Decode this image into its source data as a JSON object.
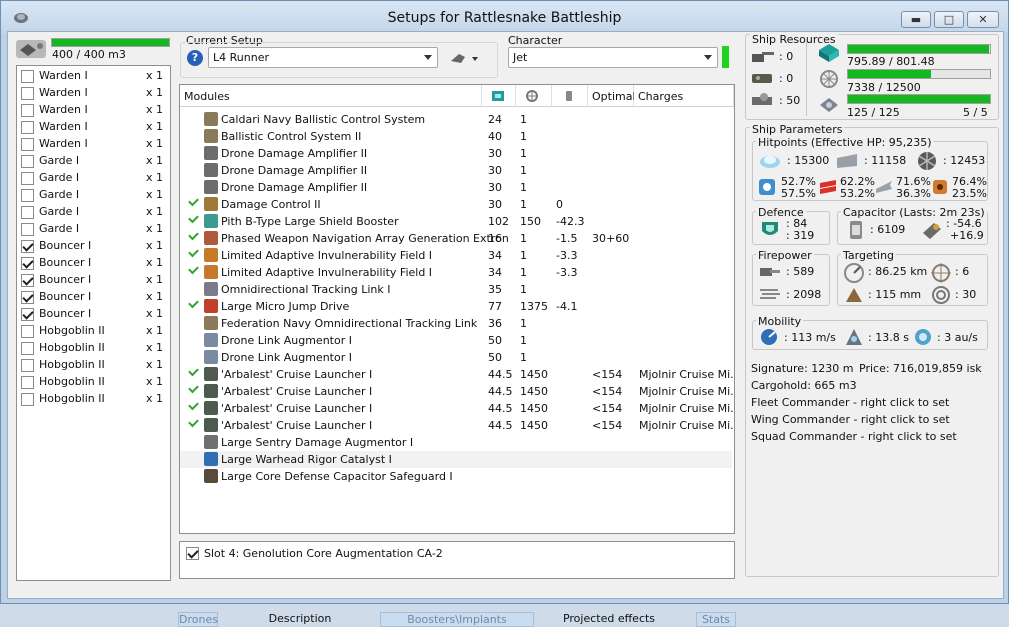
{
  "window": {
    "title": "Setups for Rattlesnake Battleship",
    "btn_min": "▬",
    "btn_max": "□",
    "btn_close": "✕"
  },
  "ship": {
    "drone_bay": "400 / 400 m3",
    "drone_bay_fraction": 1.0
  },
  "drones": [
    {
      "name": "Warden I",
      "qty": "x 1",
      "checked": false
    },
    {
      "name": "Warden I",
      "qty": "x 1",
      "checked": false
    },
    {
      "name": "Warden I",
      "qty": "x 1",
      "checked": false
    },
    {
      "name": "Warden I",
      "qty": "x 1",
      "checked": false
    },
    {
      "name": "Warden I",
      "qty": "x 1",
      "checked": false
    },
    {
      "name": "Garde I",
      "qty": "x 1",
      "checked": false
    },
    {
      "name": "Garde I",
      "qty": "x 1",
      "checked": false
    },
    {
      "name": "Garde I",
      "qty": "x 1",
      "checked": false
    },
    {
      "name": "Garde I",
      "qty": "x 1",
      "checked": false
    },
    {
      "name": "Garde I",
      "qty": "x 1",
      "checked": false
    },
    {
      "name": "Bouncer I",
      "qty": "x 1",
      "checked": true
    },
    {
      "name": "Bouncer I",
      "qty": "x 1",
      "checked": true
    },
    {
      "name": "Bouncer I",
      "qty": "x 1",
      "checked": true
    },
    {
      "name": "Bouncer I",
      "qty": "x 1",
      "checked": true
    },
    {
      "name": "Bouncer I",
      "qty": "x 1",
      "checked": true
    },
    {
      "name": "Hobgoblin II",
      "qty": "x 1",
      "checked": false
    },
    {
      "name": "Hobgoblin II",
      "qty": "x 1",
      "checked": false
    },
    {
      "name": "Hobgoblin II",
      "qty": "x 1",
      "checked": false
    },
    {
      "name": "Hobgoblin II",
      "qty": "x 1",
      "checked": false
    },
    {
      "name": "Hobgoblin II",
      "qty": "x 1",
      "checked": false
    }
  ],
  "setup": {
    "label": "Current Setup",
    "value": "L4 Runner"
  },
  "character": {
    "label": "Character",
    "value": "Jet"
  },
  "modules": {
    "headers": {
      "name": "Modules",
      "optimal": "Optimal",
      "charges": "Charges"
    },
    "rows": [
      {
        "active": false,
        "icon": "#8a7a5a",
        "name": "Caldari Navy Ballistic Control System",
        "c1": "24",
        "c2": "1",
        "c3": "",
        "c4": "",
        "c5": ""
      },
      {
        "active": false,
        "icon": "#8a7a5a",
        "name": "Ballistic Control System II",
        "c1": "40",
        "c2": "1",
        "c3": "",
        "c4": "",
        "c5": ""
      },
      {
        "active": false,
        "icon": "#6c6c6c",
        "name": "Drone Damage Amplifier II",
        "c1": "30",
        "c2": "1",
        "c3": "",
        "c4": "",
        "c5": ""
      },
      {
        "active": false,
        "icon": "#6c6c6c",
        "name": "Drone Damage Amplifier II",
        "c1": "30",
        "c2": "1",
        "c3": "",
        "c4": "",
        "c5": ""
      },
      {
        "active": false,
        "icon": "#6c6c6c",
        "name": "Drone Damage Amplifier II",
        "c1": "30",
        "c2": "1",
        "c3": "",
        "c4": "",
        "c5": ""
      },
      {
        "active": true,
        "icon": "#a07838",
        "name": "Damage Control II",
        "c1": "30",
        "c2": "1",
        "c3": "0",
        "c4": "",
        "c5": ""
      },
      {
        "active": true,
        "icon": "#3c9a8e",
        "name": "Pith B-Type Large Shield Booster",
        "c1": "102",
        "c2": "150",
        "c3": "-42.3",
        "c4": "",
        "c5": ""
      },
      {
        "active": true,
        "icon": "#b05a3c",
        "name": "Phased Weapon Navigation Array Generation Extron",
        "c1": "16",
        "c2": "1",
        "c3": "-1.5",
        "c4": "30+60",
        "c5": ""
      },
      {
        "active": true,
        "icon": "#c77b2a",
        "name": "Limited Adaptive Invulnerability Field I",
        "c1": "34",
        "c2": "1",
        "c3": "-3.3",
        "c4": "",
        "c5": ""
      },
      {
        "active": true,
        "icon": "#c77b2a",
        "name": "Limited Adaptive Invulnerability Field I",
        "c1": "34",
        "c2": "1",
        "c3": "-3.3",
        "c4": "",
        "c5": ""
      },
      {
        "active": false,
        "icon": "#7a7a8a",
        "name": "Omnidirectional Tracking Link I",
        "c1": "35",
        "c2": "1",
        "c3": "",
        "c4": "",
        "c5": ""
      },
      {
        "active": true,
        "icon": "#c0402a",
        "name": "Large Micro Jump Drive",
        "c1": "77",
        "c2": "1375",
        "c3": "-4.1",
        "c4": "",
        "c5": ""
      },
      {
        "active": false,
        "icon": "#8a7a5a",
        "name": "Federation Navy Omnidirectional Tracking Link",
        "c1": "36",
        "c2": "1",
        "c3": "",
        "c4": "",
        "c5": ""
      },
      {
        "active": false,
        "icon": "#7a8aa0",
        "name": "Drone Link Augmentor I",
        "c1": "50",
        "c2": "1",
        "c3": "",
        "c4": "",
        "c5": ""
      },
      {
        "active": false,
        "icon": "#7a8aa0",
        "name": "Drone Link Augmentor I",
        "c1": "50",
        "c2": "1",
        "c3": "",
        "c4": "",
        "c5": ""
      },
      {
        "active": true,
        "icon": "#4e5a4e",
        "name": "'Arbalest' Cruise Launcher I",
        "c1": "44.5",
        "c2": "1450",
        "c3": "",
        "c4": "<154",
        "c5": "Mjolnir Cruise Mi..."
      },
      {
        "active": true,
        "icon": "#4e5a4e",
        "name": "'Arbalest' Cruise Launcher I",
        "c1": "44.5",
        "c2": "1450",
        "c3": "",
        "c4": "<154",
        "c5": "Mjolnir Cruise Mi..."
      },
      {
        "active": true,
        "icon": "#4e5a4e",
        "name": "'Arbalest' Cruise Launcher I",
        "c1": "44.5",
        "c2": "1450",
        "c3": "",
        "c4": "<154",
        "c5": "Mjolnir Cruise Mi..."
      },
      {
        "active": true,
        "icon": "#4e5a4e",
        "name": "'Arbalest' Cruise Launcher I",
        "c1": "44.5",
        "c2": "1450",
        "c3": "",
        "c4": "<154",
        "c5": "Mjolnir Cruise Mi..."
      },
      {
        "active": false,
        "icon": "#707070",
        "name": "Large Sentry Damage Augmentor I",
        "c1": "",
        "c2": "",
        "c3": "",
        "c4": "",
        "c5": ""
      },
      {
        "active": false,
        "icon": "#2f6fb3",
        "name": "Large Warhead Rigor Catalyst I",
        "c1": "",
        "c2": "",
        "c3": "",
        "c4": "",
        "c5": ""
      },
      {
        "active": false,
        "icon": "#5a4a3a",
        "name": "Large Core Defense Capacitor Safeguard I",
        "c1": "",
        "c2": "",
        "c3": "",
        "c4": "",
        "c5": ""
      }
    ]
  },
  "implant": {
    "label": "Slot 4: Genolution Core Augmentation CA-2",
    "checked": true
  },
  "tabs": {
    "drones": "Drones",
    "description": "Description",
    "boosters": "Boosters\\Implants",
    "projected": "Projected effects",
    "stats": "Stats"
  },
  "resources": {
    "title": "Ship Resources",
    "turrets": ": 0",
    "launchers": ": 0",
    "calibration": ": 50",
    "cpu": "795.89 / 801.48",
    "cpu_fraction": 0.993,
    "power": "7338 / 12500",
    "power_fraction": 0.587,
    "drone_bw": "125 / 125",
    "drone_bw_fraction": 1.0,
    "drones_active": "5 / 5"
  },
  "params": {
    "title": "Ship Parameters",
    "hitpoints_title": "Hitpoints (Effective HP: 95,235)",
    "shield_hp": ": 15300",
    "armor_hp": ": 11158",
    "structure_hp": ": 12453",
    "res": [
      {
        "a": "52.7%",
        "b": "57.5%"
      },
      {
        "a": "62.2%",
        "b": "53.2%"
      },
      {
        "a": "71.6%",
        "b": "36.3%"
      },
      {
        "a": "76.4%",
        "b": "23.5%"
      }
    ],
    "defence_title": "Defence",
    "def_a": ": 84",
    "def_b": ": 319",
    "capacitor_title": "Capacitor (Lasts: 2m 23s)",
    "cap_amount": ": 6109",
    "cap_a": ": -54.6",
    "cap_b": "+16.9",
    "firepower_title": "Firepower",
    "fp_a": ": 589",
    "fp_b": ": 2098",
    "targeting_title": "Targeting",
    "range": ": 86.25 km",
    "targets": ": 6",
    "scan": ": 115 mm",
    "sensor": ": 30",
    "mobility_title": "Mobility",
    "velocity": ": 113 m/s",
    "align": ": 13.8 s",
    "warp": ": 3 au/s",
    "signature": "Signature: 1230 m",
    "price": "Price: 716,019,859 isk",
    "cargo": "Cargohold: 665 m3",
    "fleet": "Fleet Commander - right click to set",
    "wing": "Wing Commander - right click to set",
    "squad": "Squad Commander - right click to set"
  }
}
